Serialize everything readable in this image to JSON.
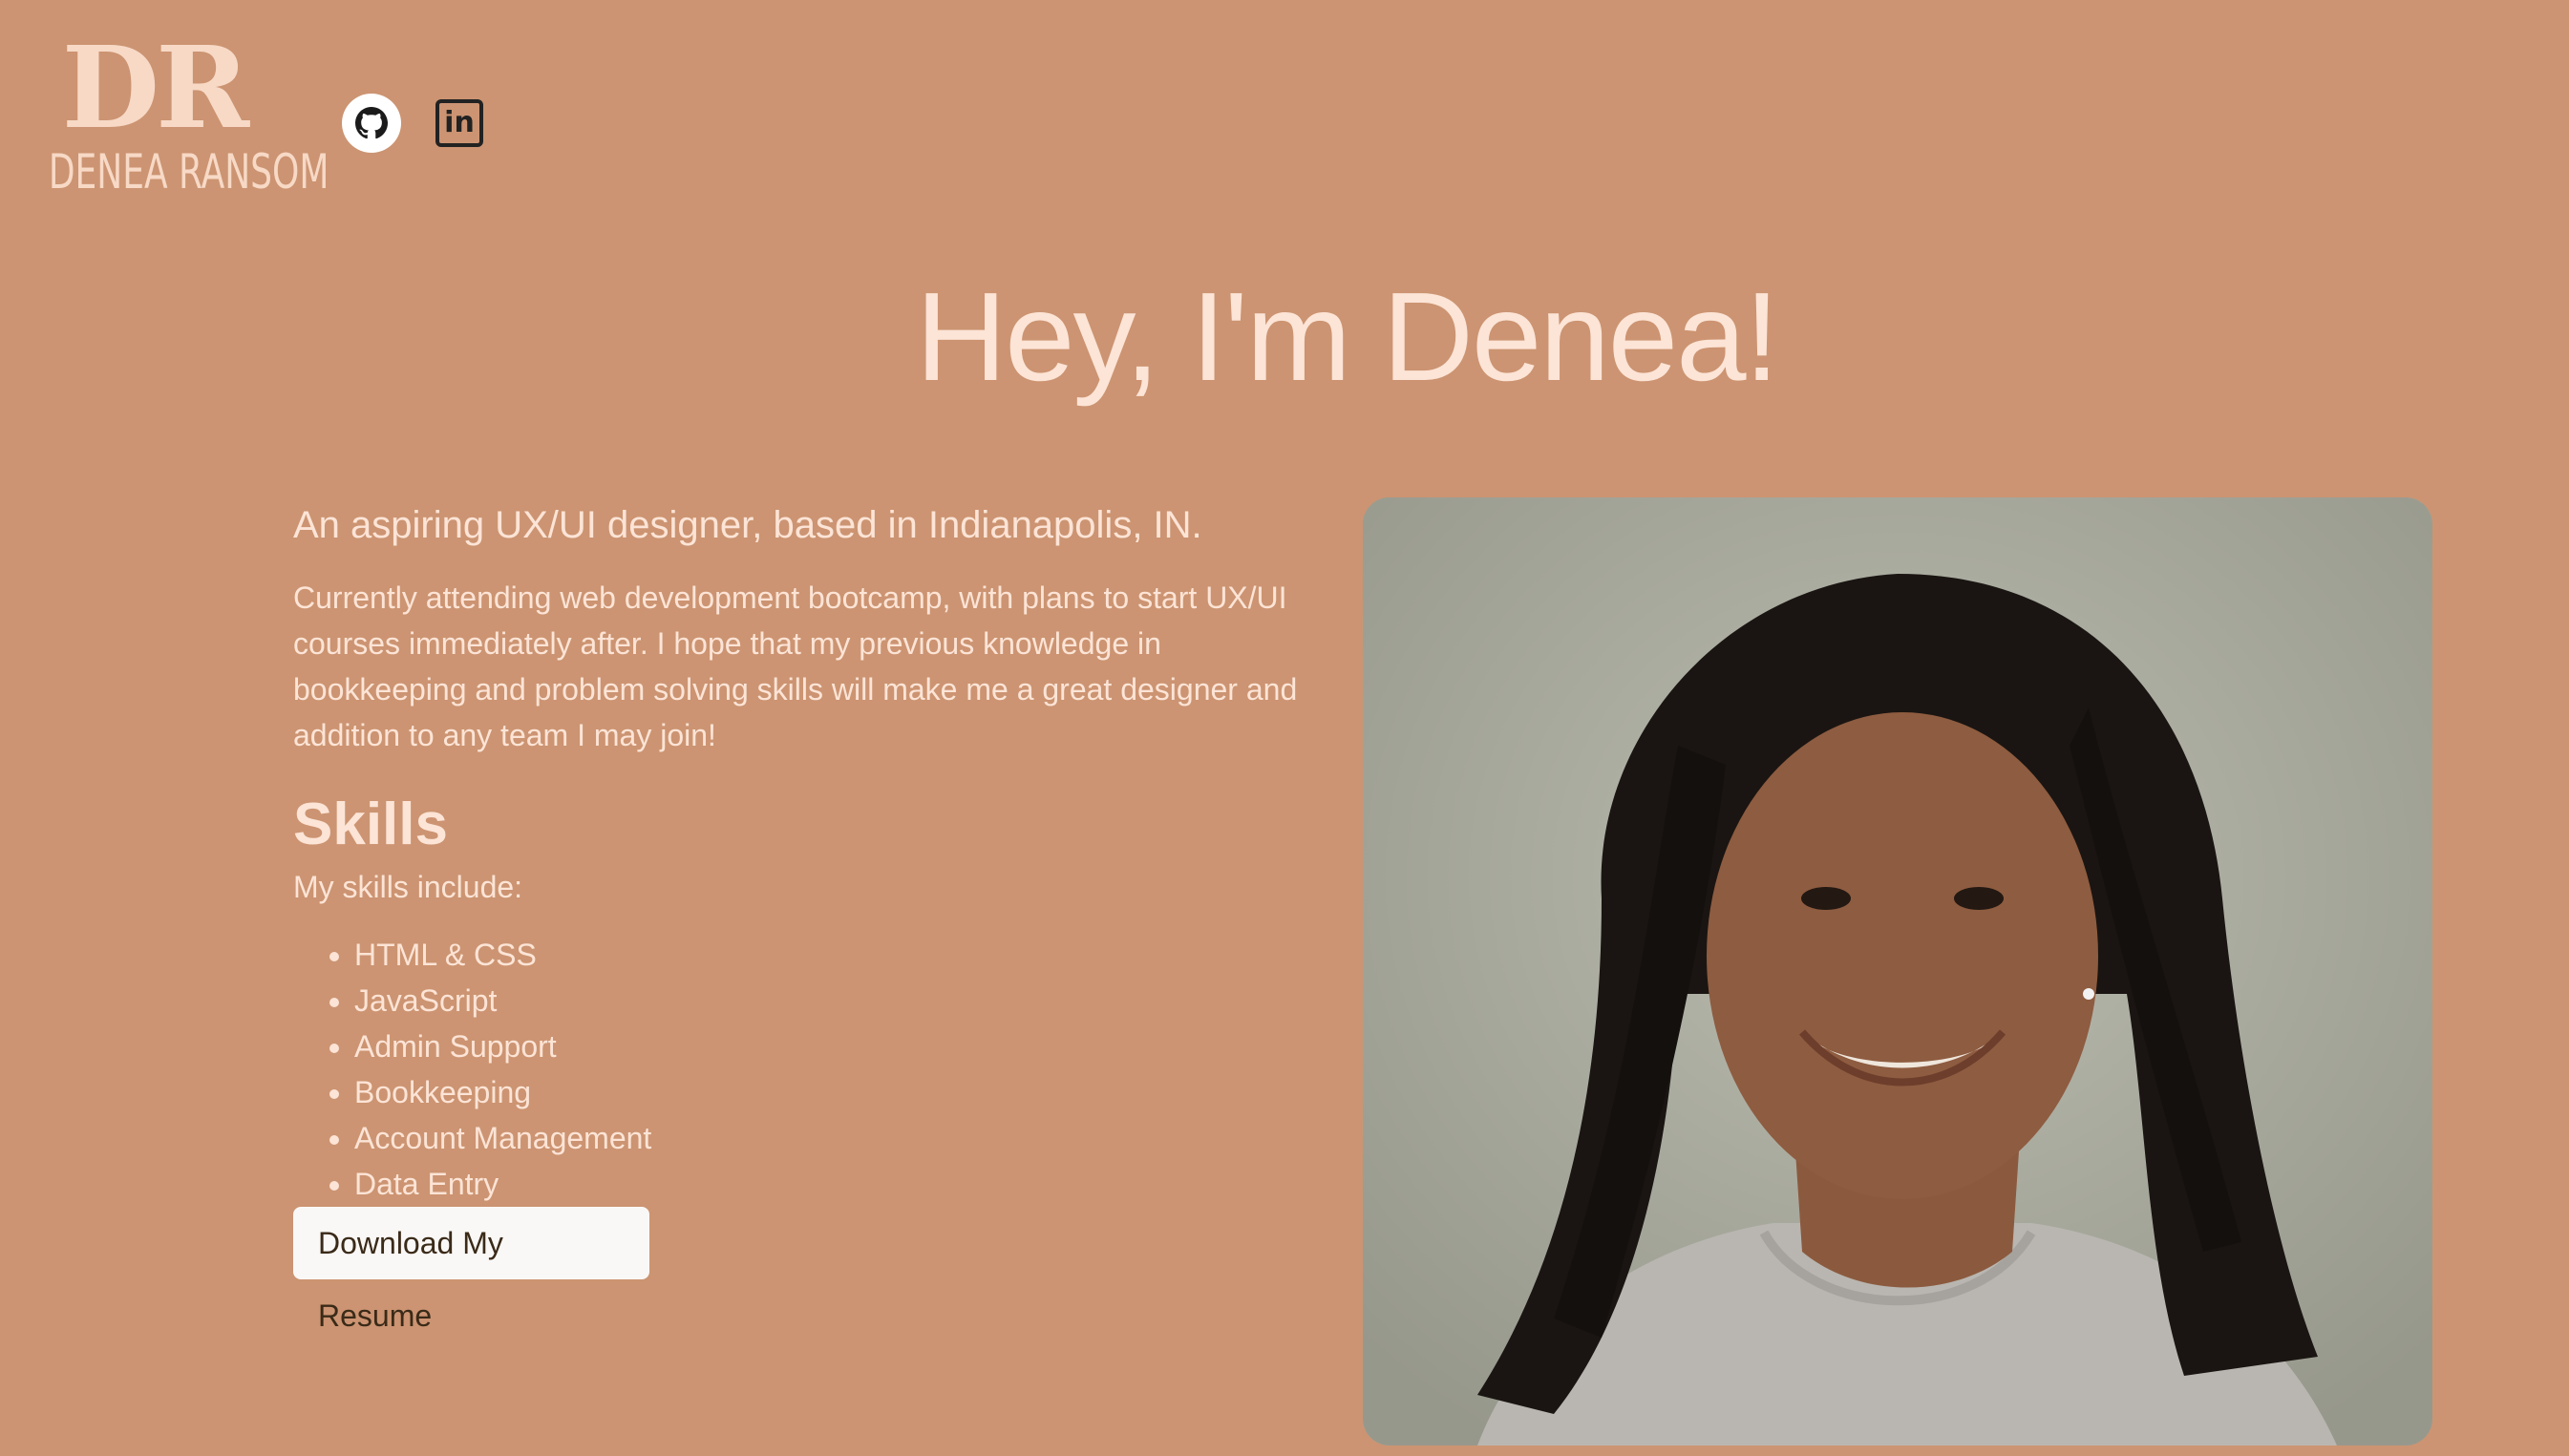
{
  "logo": {
    "mark": "DR",
    "name": "DENEA RANSOM"
  },
  "social": {
    "github_icon": "github-icon",
    "linkedin_icon": "linkedin-icon",
    "linkedin_text": "in"
  },
  "hero": {
    "title": "Hey, I'm Denea!"
  },
  "intro": {
    "tagline": "An aspiring UX/UI designer, based in Indianapolis, IN.",
    "bio": "Currently attending web development bootcamp, with plans to start UX/UI courses immediately after. I hope that my previous knowledge in bookkeeping and problem solving skills will make me a great designer and addition to any team I may join!"
  },
  "skills": {
    "heading": "Skills",
    "intro": "My skills include:",
    "items": [
      "HTML & CSS",
      "JavaScript",
      "Admin Support",
      "Bookkeeping",
      "Account Management",
      "Data Entry"
    ]
  },
  "resume_button": {
    "label": "Download My Resume"
  },
  "colors": {
    "background": "#CC9472",
    "text_light": "#FCE4D6",
    "logo": "#F7D9C6",
    "button_bg": "#FAF8F6"
  }
}
